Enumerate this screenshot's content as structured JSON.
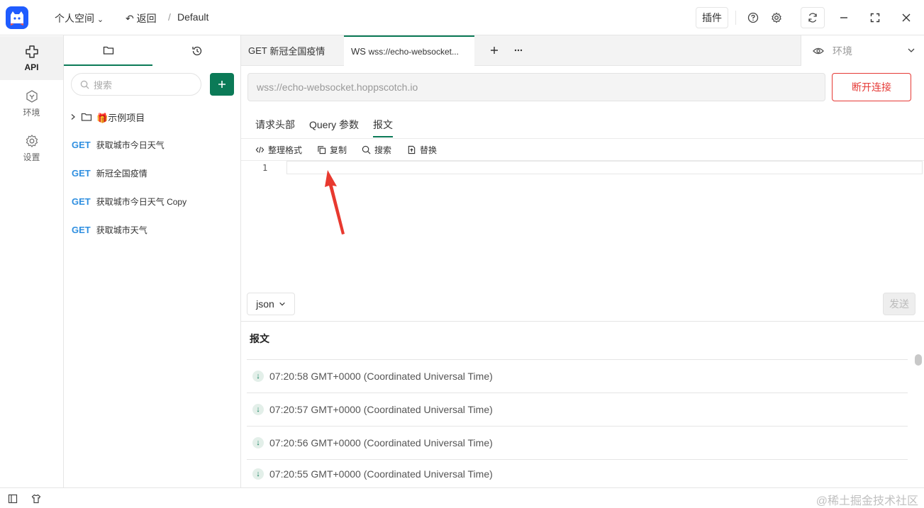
{
  "titlebar": {
    "workspace": "个人空间",
    "back": "返回",
    "separator": "/",
    "collection": "Default",
    "plugins": "插件"
  },
  "rail": {
    "items": [
      {
        "label": "API",
        "icon": "api-icon"
      },
      {
        "label": "环境",
        "icon": "environment-icon"
      },
      {
        "label": "设置",
        "icon": "settings-icon"
      }
    ]
  },
  "panel": {
    "search_placeholder": "搜索",
    "folder": {
      "emoji": "🎁",
      "name": "示例项目"
    },
    "requests": [
      {
        "method": "GET",
        "name": "获取城市今日天气"
      },
      {
        "method": "GET",
        "name": "新冠全国疫情"
      },
      {
        "method": "GET",
        "name": "获取城市今日天气 Copy"
      },
      {
        "method": "GET",
        "name": "获取城市天气"
      }
    ]
  },
  "tabs": [
    {
      "method": "GET",
      "name": "新冠全国疫情"
    },
    {
      "method": "WS",
      "name": "wss://echo-websocket..."
    }
  ],
  "environment": {
    "label": "环境"
  },
  "connection": {
    "url": "wss://echo-websocket.hoppscotch.io",
    "disconnect_label": "断开连接"
  },
  "subtabs": [
    "请求头部",
    "Query 参数",
    "报文"
  ],
  "toolbar": {
    "format": "整理格式",
    "copy": "复制",
    "search": "搜索",
    "replace": "替换"
  },
  "editor": {
    "line_number": "1"
  },
  "body_type": "json",
  "send_label": "发送",
  "messages": {
    "title": "报文",
    "items": [
      "07:20:58 GMT+0000 (Coordinated Universal Time)",
      "07:20:57 GMT+0000 (Coordinated Universal Time)",
      "07:20:56 GMT+0000 (Coordinated Universal Time)",
      "07:20:55 GMT+0000 (Coordinated Universal Time)"
    ]
  },
  "watermark": "@稀土掘金技术社区",
  "colors": {
    "accent": "#0b7a57",
    "danger": "#e53935",
    "method": "#2f8fe0",
    "arrow": "#e8392f"
  }
}
